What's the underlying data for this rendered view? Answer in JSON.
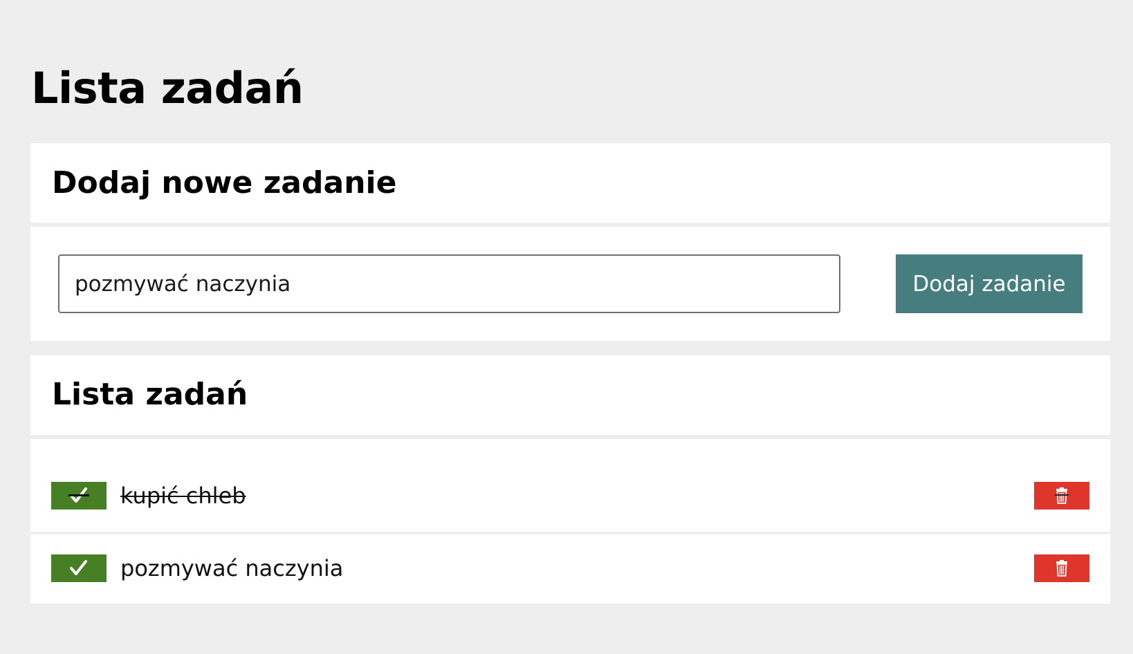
{
  "page": {
    "title": "Lista zadań",
    "background": "#eeeeee"
  },
  "add_section": {
    "heading": "Dodaj nowe zadanie",
    "input_value": "pozmywać naczynia",
    "input_placeholder": "",
    "button_label": "Dodaj zadanie",
    "button_color": "#467d7e"
  },
  "list_section": {
    "heading": "Lista zadań",
    "tasks": [
      {
        "text": "kupić chleb",
        "done": true,
        "done_icon": "check-icon",
        "delete_icon": "trash-icon"
      },
      {
        "text": "pozmywać naczynia",
        "done": false,
        "done_icon": "check-icon",
        "delete_icon": "trash-icon"
      }
    ]
  },
  "colors": {
    "done_button": "#467f24",
    "delete_button": "#e0352b",
    "panel": "#ffffff"
  }
}
